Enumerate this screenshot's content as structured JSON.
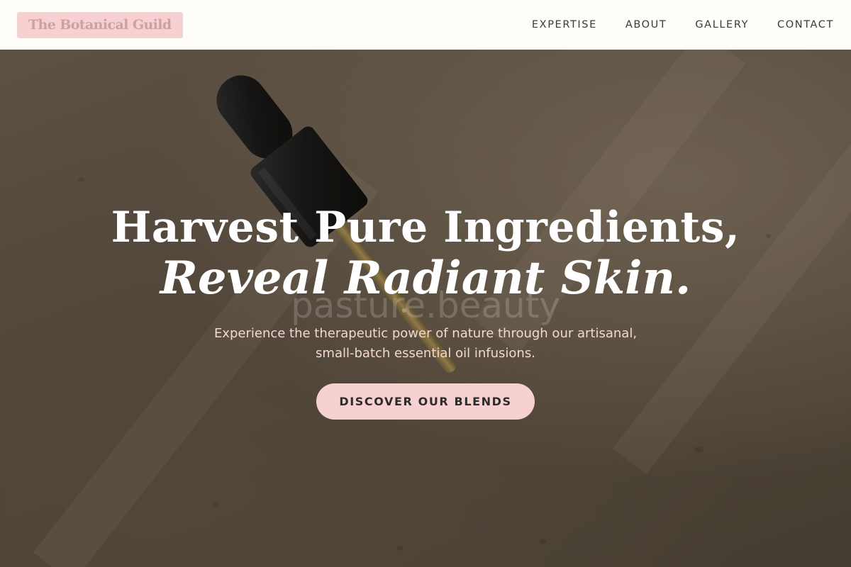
{
  "brand": {
    "name": "The Botanical Guild"
  },
  "nav": {
    "items": [
      {
        "label": "EXPERTISE"
      },
      {
        "label": "ABOUT"
      },
      {
        "label": "GALLERY"
      },
      {
        "label": "CONTACT"
      }
    ]
  },
  "hero": {
    "headline_line1": "Harvest Pure Ingredients,",
    "headline_line2": "Reveal Radiant Skin.",
    "watermark": "pasture.beauty",
    "subtext_line1": "Experience the therapeutic power of nature through our artisanal,",
    "subtext_line2": "small-batch essential oil infusions.",
    "cta_label": "DISCOVER OUR BLENDS",
    "image_subject": "dropper-bottle-on-stone"
  },
  "colors": {
    "accent_pink": "#f7d1d1",
    "header_bg": "#fffdf9",
    "nav_text": "#3a3a3a",
    "headline_text": "#ffffff",
    "subtext": "#f3d7d3"
  }
}
